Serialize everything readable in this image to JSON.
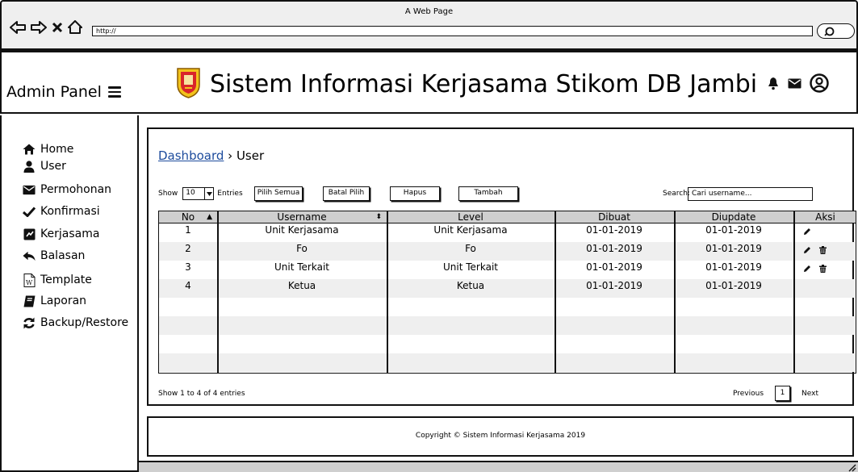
{
  "window": {
    "title": "A Web Page",
    "url": "http://"
  },
  "header": {
    "admin_label": "Admin Panel",
    "site_title": "Sistem Informasi Kerjasama Stikom DB Jambi"
  },
  "sidebar": {
    "items": [
      {
        "label": "Home",
        "icon": "home-icon"
      },
      {
        "label": "User",
        "icon": "user-icon"
      },
      {
        "label": "Permohonan",
        "icon": "envelope-icon"
      },
      {
        "label": "Konfirmasi",
        "icon": "check-icon"
      },
      {
        "label": "Kerjasama",
        "icon": "handshake-icon"
      },
      {
        "label": "Balasan",
        "icon": "reply-icon"
      },
      {
        "label": "Template",
        "icon": "word-file-icon"
      },
      {
        "label": "Laporan",
        "icon": "book-icon"
      },
      {
        "label": "Backup/Restore",
        "icon": "refresh-icon"
      }
    ]
  },
  "breadcrumb": {
    "parent": "Dashboard",
    "separator": "›",
    "current": "User"
  },
  "controls": {
    "show_label": "Show",
    "entries_value": "10",
    "entries_label": "Entries",
    "select_all": "Pilih Semua",
    "unselect": "Batal Pilih",
    "delete": "Hapus",
    "add": "Tambah",
    "search_label": "Search:",
    "search_placeholder": "Cari username..."
  },
  "table": {
    "columns": [
      "No",
      "Username",
      "Level",
      "Dibuat",
      "Diupdate",
      "Aksi"
    ],
    "rows": [
      {
        "no": "1",
        "username": "Unit Kerjasama",
        "level": "Unit Kerjasama",
        "dibuat": "01-01-2019",
        "diupdate": "01-01-2019",
        "actions": [
          "edit"
        ]
      },
      {
        "no": "2",
        "username": "Fo",
        "level": "Fo",
        "dibuat": "01-01-2019",
        "diupdate": "01-01-2019",
        "actions": [
          "edit",
          "delete"
        ]
      },
      {
        "no": "3",
        "username": "Unit Terkait",
        "level": "Unit Terkait",
        "dibuat": "01-01-2019",
        "diupdate": "01-01-2019",
        "actions": [
          "edit",
          "delete"
        ]
      },
      {
        "no": "4",
        "username": "Ketua",
        "level": "Ketua",
        "dibuat": "01-01-2019",
        "diupdate": "01-01-2019",
        "actions": []
      }
    ],
    "empty_rows": 4
  },
  "pagination": {
    "info": "Show 1 to 4 of 4 entries",
    "previous": "Previous",
    "page": "1",
    "next": "Next"
  },
  "footer": {
    "copyright": "Copyright © Sistem Informasi Kerjasama 2019"
  },
  "colors": {
    "link": "#1c4b9c",
    "header_row": "#cfcfcf",
    "alt_row": "#efefef",
    "logo_red": "#d9252a",
    "logo_yellow": "#f2c21b"
  }
}
